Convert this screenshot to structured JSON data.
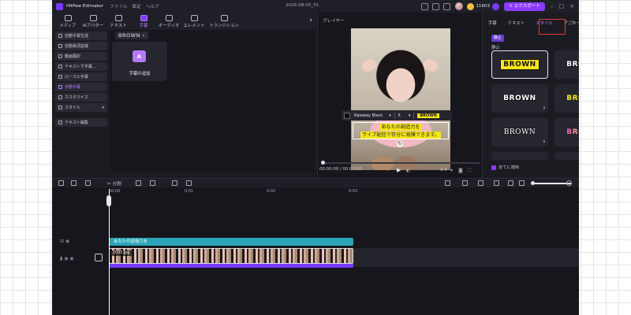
{
  "titlebar": {
    "app_name": "HitPaw Edimakor",
    "menu": [
      "ファイル",
      "設定",
      "ヘルプ"
    ],
    "document_title": "2026-08-05_01",
    "coins": "11603",
    "export_label": "エクスポート"
  },
  "toolbar": {
    "tabs": [
      {
        "label": "メディア",
        "icon": "media-icon"
      },
      {
        "label": "AIアバター",
        "icon": "avatar-icon"
      },
      {
        "label": "テキスト",
        "icon": "text-icon"
      },
      {
        "label": "字幕",
        "icon": "subtitle-icon"
      },
      {
        "label": "オーディオ",
        "icon": "audio-icon"
      },
      {
        "label": "エレメント",
        "icon": "element-icon"
      },
      {
        "label": "トランジション",
        "icon": "transition-icon"
      }
    ],
    "active_index": 3
  },
  "left_nav": {
    "items": [
      "自動字幕生成",
      "自動歌詞認識",
      "動画翻訳",
      "テキストで字幕...",
      "ローカル字幕",
      "手動字幕",
      "カスタマイズ",
      "スタイル",
      "テキスト編集"
    ],
    "active_index": 5
  },
  "content": {
    "breadcrumb": "BROWN",
    "add_subtitle_label": "字幕の追加"
  },
  "player": {
    "label": "プレイヤー",
    "font_name": "Raleway Black",
    "font_size": "5",
    "style_preview": "BROWN",
    "caption_lines": [
      "あなたの創造力を",
      "ライブ配信で存分に発揮できます。"
    ],
    "current_time": "00:00:00",
    "total_time": "00:03:00",
    "ratio": "3:4",
    "progress": 0
  },
  "right_panel": {
    "tabs": [
      "字幕",
      "テキスト",
      "スタイル",
      "アニメーション"
    ],
    "active_tab": 2,
    "filter_chip": "静止",
    "section_label": "静止",
    "styles": [
      {
        "text": "BROWN",
        "variant": "yellow-box",
        "selected": true
      },
      {
        "text": "BROWN",
        "variant": "white-bold",
        "download": true
      },
      {
        "text": "BROWN",
        "variant": "white-bold",
        "download": true
      },
      {
        "text": "BROWN",
        "variant": "yellow",
        "download": false
      },
      {
        "text": "BROWN",
        "variant": "serif",
        "download": true
      },
      {
        "text": "BROWN",
        "variant": "gradient",
        "download": true
      }
    ],
    "apply_all_label": "全てに適用",
    "apply_all_checked": true
  },
  "timeline": {
    "split_label": "分割",
    "ruler_marks": [
      "00:00",
      "0:01",
      "0:02",
      "0:03"
    ],
    "subtitle_clip_label": "あなたの創造力を",
    "video_clip_label": "0:03.jpg"
  },
  "colors": {
    "accent": "#8a3bff",
    "subtitle_clip": "#2aa6b8",
    "highlight": "#e23a3a",
    "caption_bg": "#f5e51c"
  }
}
